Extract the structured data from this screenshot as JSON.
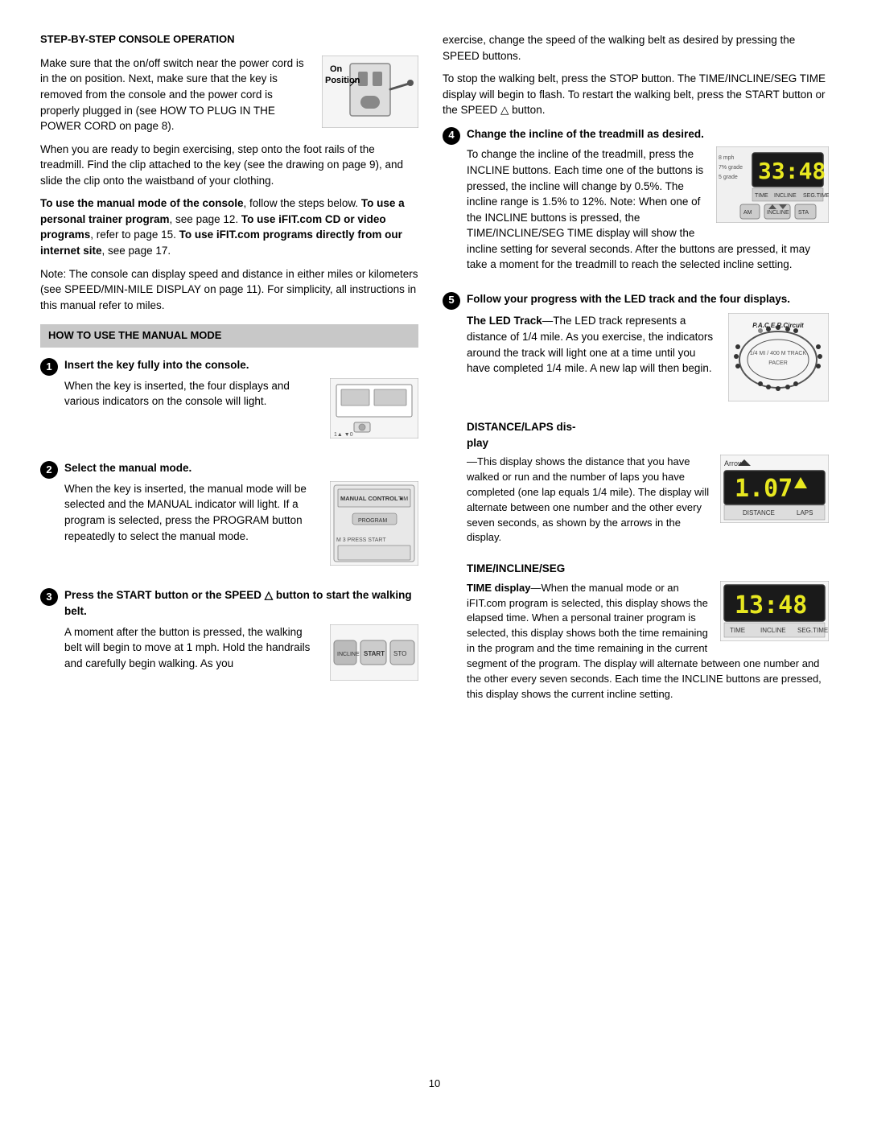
{
  "header": {
    "section_title": "STEP-BY-STEP CONSOLE OPERATION"
  },
  "left_col": {
    "intro_p1": "Make sure that the on/off switch near the power cord is in the on position. Next, make sure that the key is removed from the console and the power cord is properly plugged in (see HOW TO PLUG IN THE POWER CORD on page 8).",
    "intro_p2": "When you are ready to begin exercising, step onto the foot rails of the treadmill. Find the clip attached to the key (see the drawing on page 9), and slide the clip onto the waistband of your clothing.",
    "intro_p3_bold": "To use the manual mode of the console",
    "intro_p3_rest": ", follow the steps below. ",
    "intro_p3b_bold": "To use a personal trainer program",
    "intro_p3b_rest": ", see page 12. ",
    "intro_p3c_bold": "To use iFIT.com CD or video programs",
    "intro_p3c_rest": ", refer to page 15. ",
    "intro_p3d_bold": "To use iFIT.com programs directly from our internet site",
    "intro_p3d_rest": ", see page 17.",
    "note_p": "Note: The console can display speed and distance in either miles or kilometers (see SPEED/MIN-MILE DISPLAY on page 11). For simplicity, all instructions in this manual refer to miles.",
    "on_position_label": "On\nPosition",
    "manual_mode_header": "HOW TO USE THE MANUAL MODE",
    "step1_title": "Insert the key fully into the console.",
    "step1_text": "When the key is inserted, the four displays and various indicators on the console will light.",
    "step2_title": "Select the manual mode.",
    "step2_text": "When the key is inserted, the manual mode will be selected and the MANUAL indicator will light. If a program is selected, press the PROGRAM button repeatedly to select the manual mode.",
    "step3_title": "Press the START button or the SPEED △ button to start the walking belt.",
    "step3_text": "A moment after the button is pressed, the walking belt will begin to move at 1 mph. Hold the handrails and carefully begin walking. As you"
  },
  "right_col": {
    "right_p1": "exercise, change the speed of the walking belt as desired by pressing the SPEED buttons.",
    "right_p2": "To stop the walking belt, press the STOP button. The TIME/INCLINE/SEG TIME display will begin to flash. To restart the walking belt, press the START button or the SPEED △ button.",
    "step4_title": "Change the incline of the treadmill as desired.",
    "step4_text": "To change the incline of the treadmill, press the INCLINE buttons. Each time one of the buttons is pressed, the incline will change by 0.5%. The incline range is 1.5% to 12%. Note: When one of the INCLINE buttons is pressed, the TIME/INCLINE/SEG TIME display will show the incline setting for several seconds. After the buttons are pressed, it may take a moment for the treadmill to reach the selected incline setting.",
    "step5_title": "Follow your progress with the LED track and the four displays.",
    "led_track_title": "The LED Track",
    "led_track_text": "—The LED track represents a distance of 1/4 mile. As you exercise, the indicators around the track will light one at a time until you have completed 1/4 mile. A new lap will then begin.",
    "distance_title": "DISTANCE/LAPS dis-",
    "distance_title2": "play",
    "distance_text": "—This display shows the distance that you have walked or run and the number of laps you have completed (one lap equals 1/4 mile). The display will alternate between one number and the other every seven seconds, as shown by the arrows in the display.",
    "dist_display_value": "1.07",
    "dist_display_labels": [
      "DISTANCE",
      "LAPS"
    ],
    "dist_arrow_label": "Arrow",
    "time_title": "TIME/INCLINE/SEG",
    "time_title2": "TIME display",
    "time_text": "—When the manual mode or an iFIT.com program is selected, this display shows the elapsed time. When a personal trainer program is selected, this display shows both the time remaining in the program and the time remaining in the current segment of the program. The display will alternate between one number and the other every seven seconds. Each time the INCLINE buttons are pressed, this display shows the current incline setting.",
    "time_display_value": "13:48",
    "time_display_labels": [
      "TIME",
      "INCLINE",
      "SEG.TIME"
    ],
    "incline_display_value": "33:48",
    "incline_display_labels": [
      "TIME",
      "INCLINE",
      "SEG.TIME"
    ]
  },
  "page_number": "10"
}
